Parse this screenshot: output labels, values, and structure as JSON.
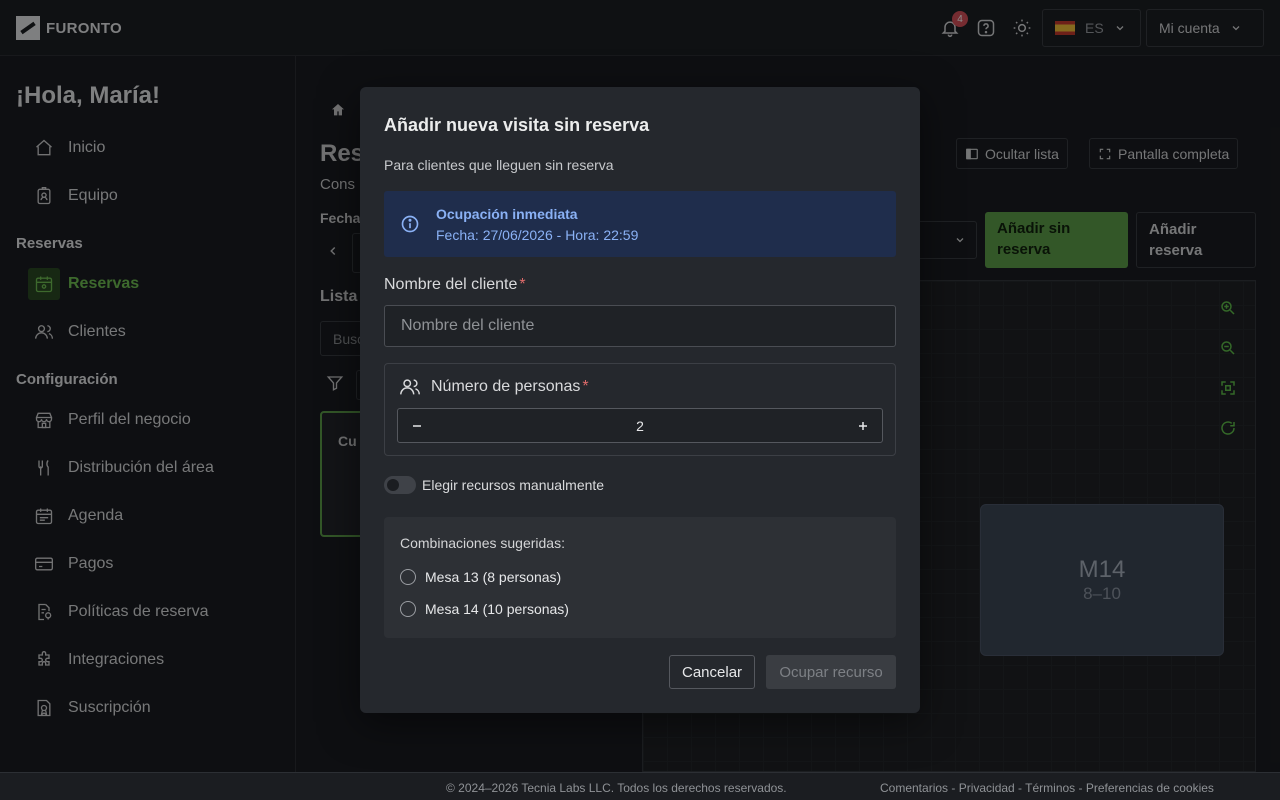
{
  "header": {
    "brand": "FURONTO",
    "notifications_count": "4",
    "language": "ES",
    "account_label": "Mi cuenta"
  },
  "sidebar": {
    "greeting": "¡Hola, María!",
    "items_top": [
      {
        "label": "Inicio",
        "icon": "home-icon"
      },
      {
        "label": "Equipo",
        "icon": "badge-icon"
      }
    ],
    "section_reservas": "Reservas",
    "items_reservas": [
      {
        "label": "Reservas",
        "icon": "calendar-icon",
        "active": true
      },
      {
        "label": "Clientes",
        "icon": "users-icon"
      }
    ],
    "section_config": "Configuración",
    "items_config": [
      {
        "label": "Perfil del negocio",
        "icon": "store-icon"
      },
      {
        "label": "Distribución del área",
        "icon": "cutlery-icon"
      },
      {
        "label": "Agenda",
        "icon": "agenda-icon"
      },
      {
        "label": "Pagos",
        "icon": "card-icon"
      },
      {
        "label": "Políticas de reserva",
        "icon": "policy-icon"
      },
      {
        "label": "Integraciones",
        "icon": "puzzle-icon"
      },
      {
        "label": "Suscripción",
        "icon": "subscription-icon"
      }
    ]
  },
  "main": {
    "title_partial": "Res",
    "subtitle_partial": "Cons",
    "date_label_partial": "Fecha",
    "list_label_partial": "Lista",
    "search_partial": "Busc",
    "card_partial": "Cu",
    "hide_list": "Ocultar lista",
    "fullscreen": "Pantalla completa",
    "add_walkin": "Añadir sin reserva",
    "add_reservation": "Añadir reserva",
    "table": {
      "name": "M14",
      "capacity": "8–10"
    }
  },
  "modal": {
    "title": "Añadir nueva visita sin reserva",
    "subtitle": "Para clientes que lleguen sin reserva",
    "info_title": "Ocupación inmediata",
    "info_text": "Fecha: 27/06/2026 - Hora: 22:59",
    "name_label": "Nombre del cliente",
    "required_mark": "*",
    "name_placeholder": "Nombre del cliente",
    "people_label": "Número de personas",
    "people_value": "2",
    "toggle_label": "Elegir recursos manualmente",
    "suggest_title": "Combinaciones sugeridas:",
    "suggestions": [
      "Mesa 13 (8 personas)",
      "Mesa 14 (10 personas)"
    ],
    "cancel": "Cancelar",
    "confirm": "Ocupar recurso"
  },
  "footer": {
    "copyright": "© 2024–2026 Tecnia Labs LLC. Todos los derechos reservados.",
    "links": "Comentarios - Privacidad - Términos - Preferencias de cookies"
  },
  "colors": {
    "accent_green": "#6fbf52",
    "info_blue": "#8ab1f5",
    "required_red": "#e06b6b"
  }
}
